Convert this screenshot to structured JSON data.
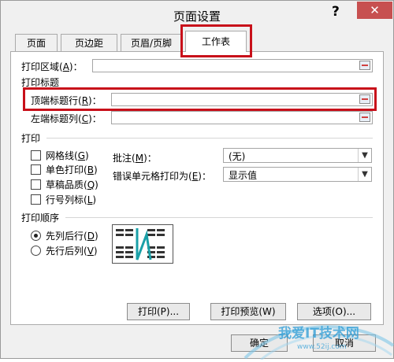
{
  "dialog": {
    "title": "页面设置",
    "help_label": "?",
    "close_label": "✕"
  },
  "tabs": [
    {
      "label": "页面",
      "active": false
    },
    {
      "label": "页边距",
      "active": false
    },
    {
      "label": "页眉/页脚",
      "active": false
    },
    {
      "label": "工作表",
      "active": true
    }
  ],
  "print_area": {
    "label": "打印区域",
    "key": "A",
    "value": ""
  },
  "print_titles": {
    "heading": "打印标题",
    "top_rows": {
      "label": "顶端标题行",
      "key": "R",
      "value": ""
    },
    "left_cols": {
      "label": "左端标题列",
      "key": "C",
      "value": ""
    }
  },
  "print_section": {
    "heading": "打印",
    "options": [
      {
        "label": "网格线",
        "key": "G",
        "checked": false
      },
      {
        "label": "单色打印",
        "key": "B",
        "checked": false
      },
      {
        "label": "草稿品质",
        "key": "Q",
        "checked": false
      },
      {
        "label": "行号列标",
        "key": "L",
        "checked": false
      }
    ],
    "comments": {
      "label": "批注",
      "key": "M",
      "value": "(无)"
    },
    "errors": {
      "label": "错误单元格打印为",
      "key": "E",
      "value": "显示值"
    }
  },
  "page_order": {
    "heading": "打印顺序",
    "options": [
      {
        "label": "先列后行",
        "key": "D",
        "selected": true
      },
      {
        "label": "先行后列",
        "key": "V",
        "selected": false
      }
    ]
  },
  "buttons": {
    "print": "打印(P)...",
    "preview": "打印预览(W)",
    "options": "选项(O)...",
    "ok": "确定",
    "cancel": "取消"
  },
  "colors": {
    "highlight": "#c8101a",
    "close": "#c75050"
  },
  "watermark": {
    "text": "我爱IT技术网",
    "url": "www.52ij.com"
  }
}
